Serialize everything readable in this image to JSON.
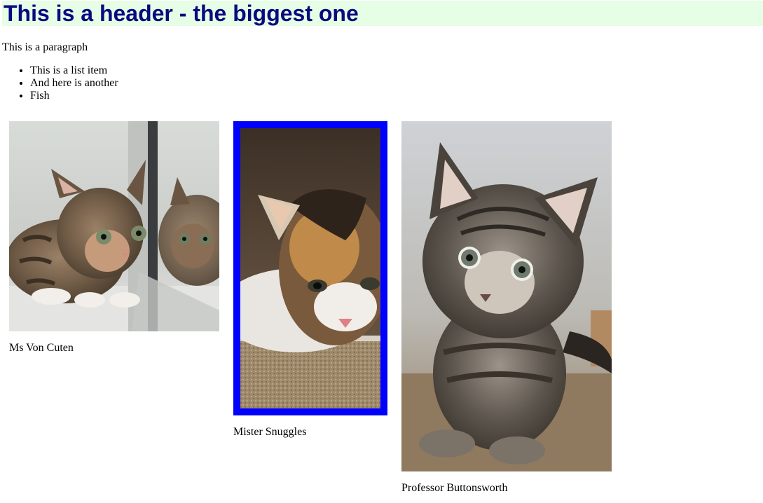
{
  "header": {
    "title": "This is a header - the biggest one"
  },
  "intro": {
    "paragraph": "This is a paragraph"
  },
  "list": {
    "items": [
      "This is a list item",
      "And here is another",
      "Fish"
    ]
  },
  "kittens": [
    {
      "name": "Ms Von Cuten"
    },
    {
      "name": "Mister Snuggles"
    },
    {
      "name": "Professor Buttonsworth"
    }
  ],
  "colors": {
    "header_bg": "#e6fde6",
    "header_text": "#0a0a80",
    "frame": "#0000ff"
  }
}
